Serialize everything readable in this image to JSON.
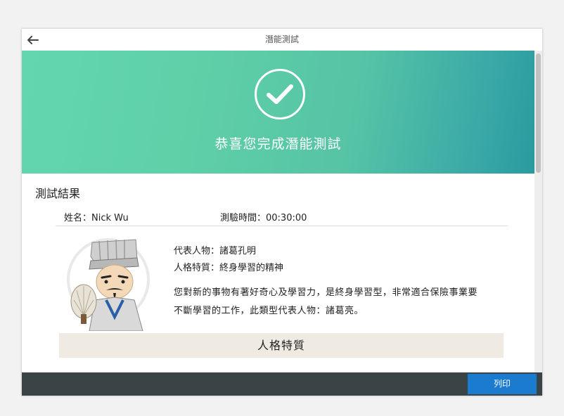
{
  "header": {
    "title": "潛能測試",
    "back_icon": "arrow-left-icon"
  },
  "hero": {
    "icon": "checkmark-circle-icon",
    "message": "恭喜您完成潛能測試"
  },
  "results": {
    "section_title": "測試結果",
    "name_line": "姓名：Nick Wu",
    "time_line": "測驗時間：00:30:00",
    "avatar_icon": "zhuge-liang-avatar",
    "representative": "代表人物：諸葛孔明",
    "trait_line": "人格特質：終身學習的精神",
    "description_line1": "您對新的事物有著好奇心及學習力，是終身學習型，非常適合保險事業要",
    "description_line2": "不斷學習的工作，此類型代表人物：諸葛亮。",
    "trait_section_title": "人格特質"
  },
  "footer": {
    "print_label": "列印"
  },
  "colors": {
    "hero_start": "#63d6b0",
    "hero_end": "#2b9aa0",
    "print_button": "#1a7bcf",
    "footer": "#3a4346",
    "trait_bar": "#efebe2"
  }
}
